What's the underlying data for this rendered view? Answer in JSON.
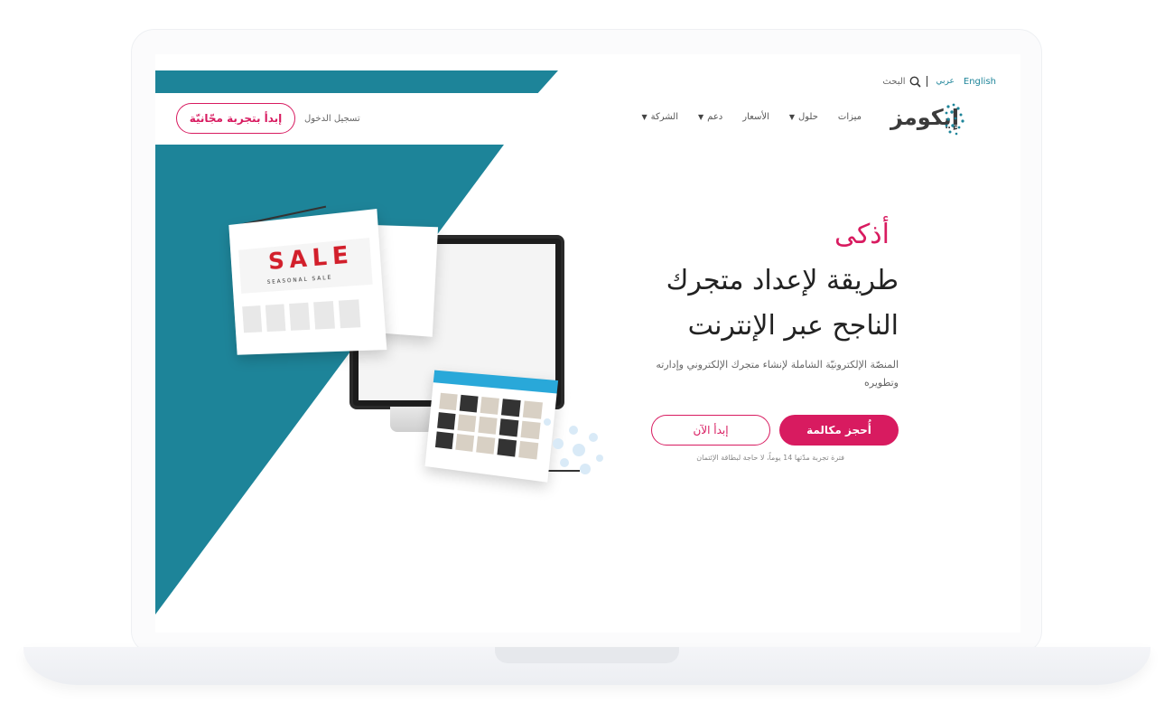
{
  "header": {
    "lang_english": "English",
    "lang_arabic": "عربي",
    "search_label": "البحث",
    "logo_text": "إيكومز"
  },
  "nav": {
    "items": [
      {
        "label": "ميزات",
        "has_dropdown": false
      },
      {
        "label": "حلول",
        "has_dropdown": true
      },
      {
        "label": "الأسعار",
        "has_dropdown": false
      },
      {
        "label": "دعم",
        "has_dropdown": true
      },
      {
        "label": "الشركة",
        "has_dropdown": true
      }
    ],
    "login": "تسجيل الدخول",
    "trial_button": "إبدأ بتجربة مجّانيّة"
  },
  "hero": {
    "accent": "أذكى",
    "title_line1": "طريقة لإعداد متجرك",
    "title_line2": "الناجح عبر الإنترنت",
    "description": "المنصّة الإلكترونيّة الشاملة لإنشاء متجرك الإلكتروني وإدارته وتطويره",
    "cta_primary": "أُحجز مكالمة",
    "cta_secondary": "إبدأ الآن",
    "note": "فترة تجربة مدّتها 14 يوماً، لا حاجة لبطاقة الإئتمان"
  },
  "mockup": {
    "sale_text": "SALE",
    "sale_subtitle": "SEASONAL SALE"
  },
  "colors": {
    "teal": "#1d8499",
    "pink": "#d81b60",
    "text_dark": "#222222"
  },
  "icons": {
    "search": "search-icon",
    "chevron": "chevron-down-icon",
    "logo": "dotted-logo-icon"
  }
}
